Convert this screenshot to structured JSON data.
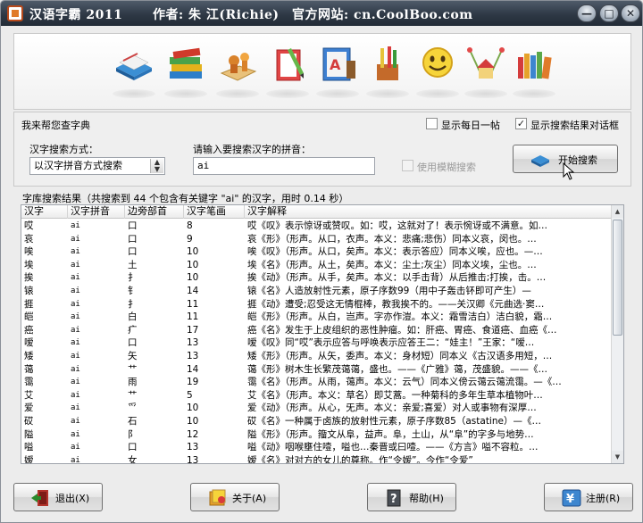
{
  "titlebar": {
    "app_name": "汉语字霸 2011",
    "author": "作者: 朱 江(Richie)",
    "website": "官方网站: cn.CoolBoo.com",
    "minimize": "—",
    "maximize": "□",
    "close": "✕"
  },
  "toolbar": {
    "icons": [
      "dictionary-icon",
      "books-icon",
      "chess-icon",
      "pencil-book-icon",
      "abc-book-icon",
      "tools-icon",
      "smiley-icon",
      "hanging-house-icon",
      "bookshelf-icon"
    ]
  },
  "search": {
    "group_title": "我来帮您查字典",
    "mode_label": "汉字搜索方式：",
    "mode_value": "以汉字拼音方式搜索",
    "pinyin_label": "请输入要搜索汉字的拼音：",
    "pinyin_value": "ai",
    "show_daily_label": "显示每日一帖",
    "show_daily_checked": false,
    "show_result_dialog_label": "显示搜索结果对话框",
    "show_result_dialog_checked": true,
    "fuzzy_label": "使用模糊搜索",
    "fuzzy_checked": false,
    "start_button": "开始搜索"
  },
  "results": {
    "caption": "字库搜索结果（共搜索到 44 个包含有关键字 \"ai\" 的汉字，用时 0.14 秒）",
    "columns": [
      "汉字",
      "汉字拼音",
      "边旁部首",
      "汉字笔画",
      "汉字解释"
    ],
    "rows": [
      [
        "哎",
        "ai",
        "口",
        "8",
        "哎《叹》表示惊讶或赞叹。如：哎，这就对了！表示惋讶或不满意。如…"
      ],
      [
        "哀",
        "ai",
        "口",
        "9",
        "哀《形》（形声。从口，衣声。本义：悲痛;悲伤）同本义哀，闵也。…"
      ],
      [
        "唉",
        "ai",
        "口",
        "10",
        "唉《叹》（形声。从口，矣声。本义：表示答应）同本义唉，应也。—…"
      ],
      [
        "埃",
        "ai",
        "土",
        "10",
        "埃《名》（形声。从土，矣声。本义：尘土;灰尘）同本义埃，尘也。…"
      ],
      [
        "挨",
        "ai",
        "扌",
        "10",
        "挨《动》（形声。从手，矣声。本义：以手击背）从后推击;打挨，击。…"
      ],
      [
        "锿",
        "ai",
        "钅",
        "14",
        "锿《名》人造放射性元素，原子序数99（用中子轰击钚即可产生）—"
      ],
      [
        "捱",
        "ai",
        "扌",
        "11",
        "捱《动》遭受;忍受这无情棍棒，教我挨不的。——关汉卿《元曲选·窦…"
      ],
      [
        "皑",
        "ai",
        "白",
        "11",
        "皑《形》（形声。从白，岂声。字亦作溰。本义：霜雪洁白）洁白貌，霜…"
      ],
      [
        "癌",
        "ai",
        "疒",
        "17",
        "癌《名》发生于上皮组织的恶性肿瘤。如：肝癌、胃癌、食道癌、血癌《…"
      ],
      [
        "嗳",
        "ai",
        "口",
        "13",
        "嗳《叹》同“哎”表示应答与呼唤表示应答王二：“娃主！”王家：“嗳…"
      ],
      [
        "矮",
        "ai",
        "矢",
        "13",
        "矮《形》（形声。从矢，委声。本义：身材短）同本义《古汉语多用短，…"
      ],
      [
        "蔼",
        "ai",
        "艹",
        "14",
        "蔼《形》树木生长繁茂蔼蔼，盛也。——《广雅》蔼，茂盛貌。——《…"
      ],
      [
        "霭",
        "ai",
        "雨",
        "19",
        "霭《名》（形声。从雨，蔼声。本义：云气）同本义傍云蔼云蔼流霭。—《…"
      ],
      [
        "艾",
        "ai",
        "艹",
        "5",
        "艾《名》（形声。本义：草名）即艾蒿。一种菊科的多年生草本植物叶…"
      ],
      [
        "爱",
        "ai",
        "爫",
        "10",
        "爱《动》（形声。从心，旡声。本义：亲爱;喜爱）对人或事物有深厚…"
      ],
      [
        "砹",
        "ai",
        "石",
        "10",
        "砹《名》一种属于卤族的放射性元素，原子序数85（astatine）—《…"
      ],
      [
        "隘",
        "ai",
        "阝",
        "12",
        "隘《形》（形声。籀文从阜，益声。阜，土山，从“阜”的字多与地势…"
      ],
      [
        "嗌",
        "ai",
        "口",
        "13",
        "嗌《动》咽喉壅住噎，嗌也…秦晋或曰噎。——《方言》嗌不容粒。…"
      ],
      [
        "嫒",
        "ai",
        "女",
        "13",
        "嫒《名》对对方的女儿的尊称。作“令嫒”。今作“令爱”"
      ],
      [
        "碍",
        "ai",
        "石",
        "13",
        "碍《动》（形声。从石，疑声。本义：妨碍，阻挡）同本义碍，碍，止也。…"
      ],
      [
        "暧",
        "ai",
        "日",
        "14",
        "暧《形》（形声。从日，爱声。本义：昏暗不明的样子）同本义时暧暧…"
      ],
      [
        "瑷",
        "ai",
        "王",
        "14",
        "瑷《名》1、美玉瑷，美玉。——《玉篇》2、又作地名用字。瑷珲，…"
      ],
      [
        "僾",
        "ai",
        "亻",
        "15",
        "僾《动》仿佛;好像僾，仿佛也。从人，爱声。——《说文》僾然必有见…"
      ]
    ]
  },
  "buttons": {
    "exit": "退出(X)",
    "about": "关于(A)",
    "help": "帮助(H)",
    "register": "注册(R)"
  }
}
